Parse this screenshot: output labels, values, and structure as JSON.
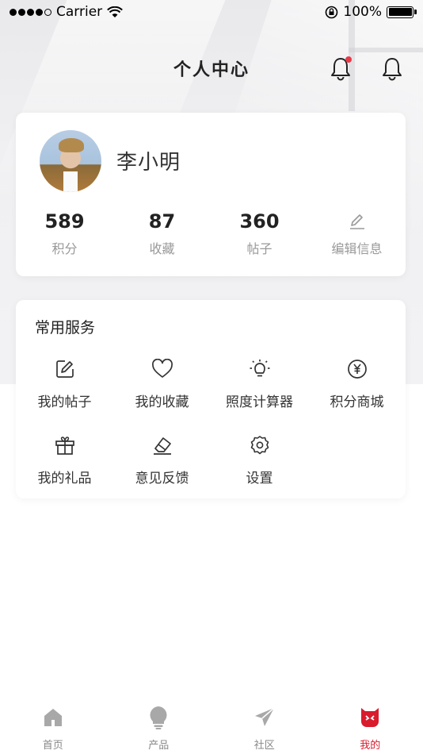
{
  "status_bar": {
    "carrier": "Carrier",
    "battery": "100%"
  },
  "header": {
    "title": "个人中心"
  },
  "profile": {
    "name": "李小明",
    "stats": [
      {
        "value": "589",
        "label": "积分"
      },
      {
        "value": "87",
        "label": "收藏"
      },
      {
        "value": "360",
        "label": "帖子"
      }
    ],
    "edit_label": "编辑信息"
  },
  "services": {
    "title": "常用服务",
    "items": [
      {
        "label": "我的帖子",
        "icon": "edit-icon"
      },
      {
        "label": "我的收藏",
        "icon": "heart-icon"
      },
      {
        "label": "照度计算器",
        "icon": "bulb-icon"
      },
      {
        "label": "积分商城",
        "icon": "yen-icon"
      },
      {
        "label": "我的礼品",
        "icon": "gift-icon"
      },
      {
        "label": "意见反馈",
        "icon": "eraser-icon"
      },
      {
        "label": "设置",
        "icon": "gear-icon"
      }
    ]
  },
  "tabs": [
    {
      "label": "首页",
      "icon": "home-icon"
    },
    {
      "label": "产品",
      "icon": "bulb-icon"
    },
    {
      "label": "社区",
      "icon": "paper-plane-icon"
    },
    {
      "label": "我的",
      "icon": "user-face-icon",
      "active": true
    }
  ],
  "colors": {
    "accent": "#d81b2d",
    "notification_dot": "#e8394a",
    "muted_text": "#999999"
  }
}
